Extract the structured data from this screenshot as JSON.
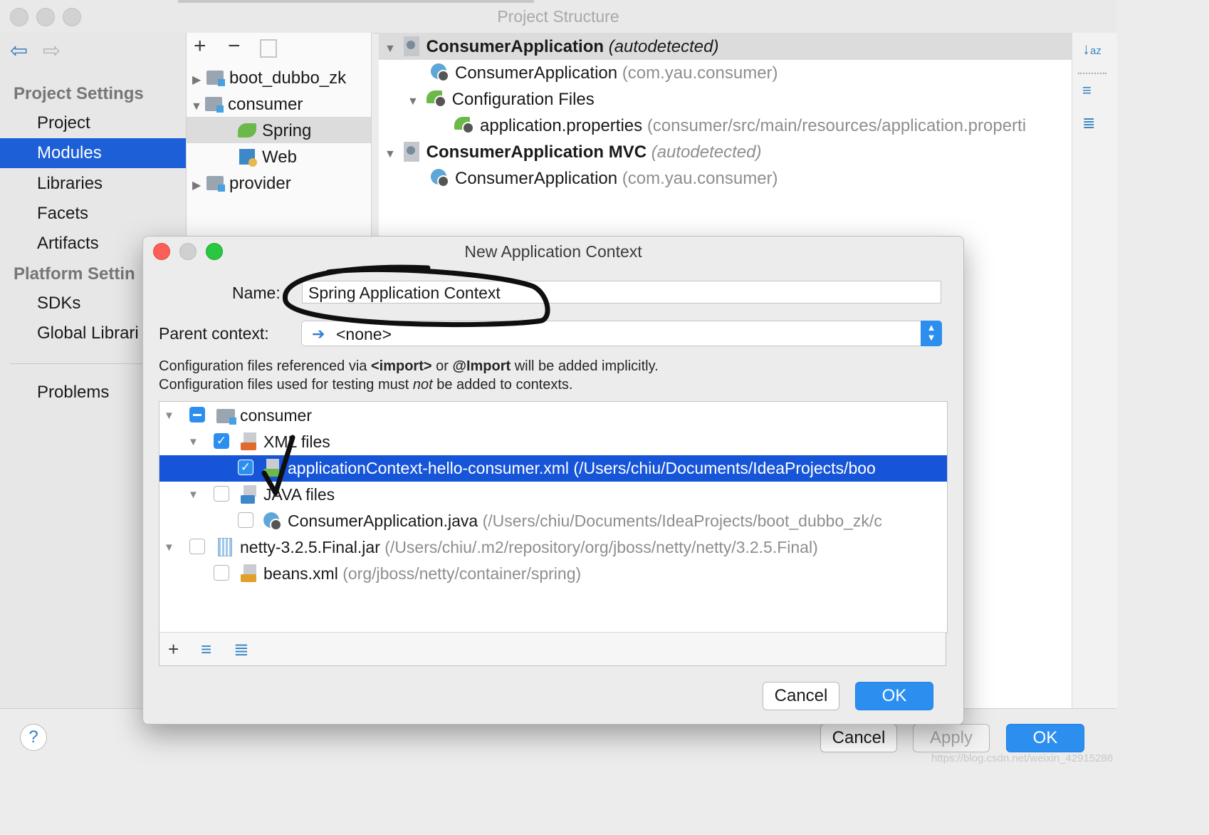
{
  "window": {
    "title": "Project Structure"
  },
  "nav": {
    "back_icon": "arrow-left-icon",
    "forward_icon": "arrow-right-icon"
  },
  "sidebar": {
    "project_settings_heading": "Project Settings",
    "project_items": [
      {
        "label": "Project",
        "selected": false
      },
      {
        "label": "Modules",
        "selected": true
      },
      {
        "label": "Libraries",
        "selected": false
      },
      {
        "label": "Facets",
        "selected": false
      },
      {
        "label": "Artifacts",
        "selected": false
      }
    ],
    "platform_settings_heading": "Platform Settin",
    "platform_items": [
      {
        "label": "SDKs"
      },
      {
        "label": "Global Librari"
      }
    ],
    "problems_label": "Problems"
  },
  "modules_panel": {
    "add_glyph": "+",
    "remove_glyph": "−",
    "copy_icon": "copy-icon",
    "tree": [
      {
        "label": "boot_dubbo_zk",
        "expanded": false
      },
      {
        "label": "consumer",
        "expanded": true
      },
      {
        "label": "Spring",
        "selected": true
      },
      {
        "label": "Web"
      },
      {
        "label": "provider",
        "expanded": false
      }
    ]
  },
  "spring_panel": {
    "rows": [
      {
        "name": "ConsumerApplication",
        "suffix": "(autodetected)"
      },
      {
        "name": "ConsumerApplication",
        "suffix": "(com.yau.consumer)"
      },
      {
        "name": "Configuration Files",
        "suffix": ""
      },
      {
        "name": "application.properties",
        "suffix": "(consumer/src/main/resources/application.properti"
      },
      {
        "name": "ConsumerApplication MVC",
        "suffix": "(autodetected)"
      },
      {
        "name": "ConsumerApplication",
        "suffix": "(com.yau.consumer)"
      }
    ],
    "side_icons": [
      "sort-alpha-icon",
      "expand-all-icon",
      "collapse-all-icon"
    ],
    "sort_glyph": "↓ᵃ𝓏"
  },
  "bottom": {
    "help_label": "?",
    "cancel_label": "Cancel",
    "apply_label": "Apply",
    "ok_label": "OK",
    "watermark": "https://blog.csdn.net/weixin_42915286"
  },
  "dialog": {
    "title": "New Application Context",
    "name_label": "Name:",
    "name_value": "Spring Application Context",
    "parent_label": "Parent context:",
    "parent_value": "<none>",
    "hint_line1": {
      "a": "Configuration files referenced via ",
      "b": "<import>",
      "c": " or ",
      "d": "@Import",
      "e": " will be added implicitly."
    },
    "hint_line2": {
      "a": "Configuration files used for testing must ",
      "b": "not",
      "c": " be added to contexts."
    },
    "tree": [
      {
        "label": "consumer",
        "path": "",
        "state": "partial"
      },
      {
        "label": "XML files",
        "path": "",
        "state": "checked"
      },
      {
        "label": "applicationContext-hello-consumer.xml",
        "path": "(/Users/chiu/Documents/IdeaProjects/boo",
        "state": "checked",
        "selected": true
      },
      {
        "label": "JAVA files",
        "path": "",
        "state": "unchecked"
      },
      {
        "label": "ConsumerApplication.java",
        "path": "(/Users/chiu/Documents/IdeaProjects/boot_dubbo_zk/c",
        "state": "unchecked"
      },
      {
        "label": "netty-3.2.5.Final.jar",
        "path": "(/Users/chiu/.m2/repository/org/jboss/netty/netty/3.2.5.Final)",
        "state": "unchecked"
      },
      {
        "label": "beans.xml",
        "path": "(org/jboss/netty/container/spring)",
        "state": "unchecked"
      }
    ],
    "toolbar": {
      "add_glyph": "+",
      "expand_icon": "expand-all-icon",
      "collapse_icon": "collapse-all-icon"
    },
    "cancel_label": "Cancel",
    "ok_label": "OK",
    "checkmark_glyph": "✓"
  },
  "colors": {
    "selection_blue": "#1d5fd6",
    "primary_button": "#2c8ff0",
    "spring_green": "#6cb84a",
    "close_red": "#fc5f57",
    "zoom_green": "#28c840"
  }
}
